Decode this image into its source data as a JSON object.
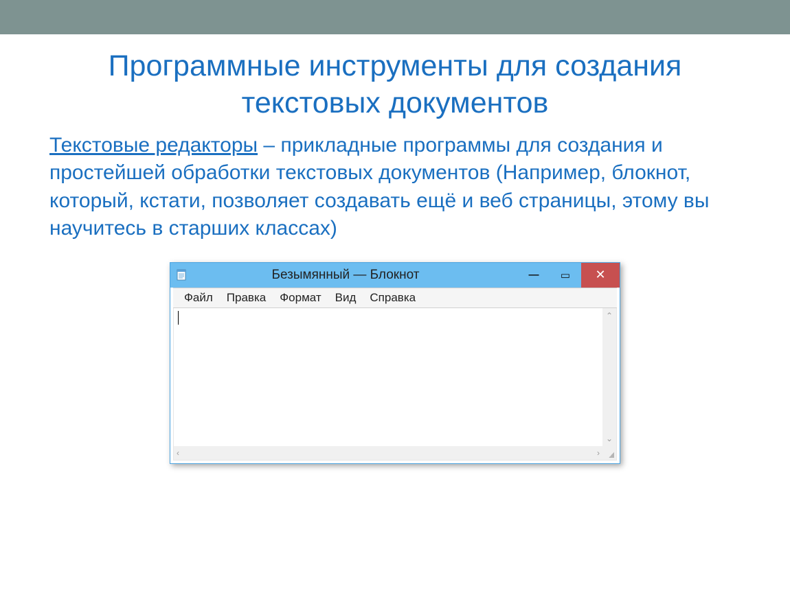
{
  "slide": {
    "title": "Программные инструменты для создания текстовых документов",
    "term": "Текстовые редакторы",
    "body_rest": " – прикладные программы для создания и простейшей обработки текстовых документов (Например, блокнот, который, кстати, позволяет создавать ещё и веб страницы, этому вы научитесь в старших классах)"
  },
  "notepad": {
    "title": "Безымянный — Блокнот",
    "menu": {
      "file": "Файл",
      "edit": "Правка",
      "format": "Формат",
      "view": "Вид",
      "help": "Справка"
    },
    "minimize_glyph": "—",
    "maximize_glyph": "▭",
    "close_glyph": "✕",
    "scroll_up": "⌃",
    "scroll_down": "⌄",
    "scroll_left": "‹",
    "scroll_right": "›"
  }
}
